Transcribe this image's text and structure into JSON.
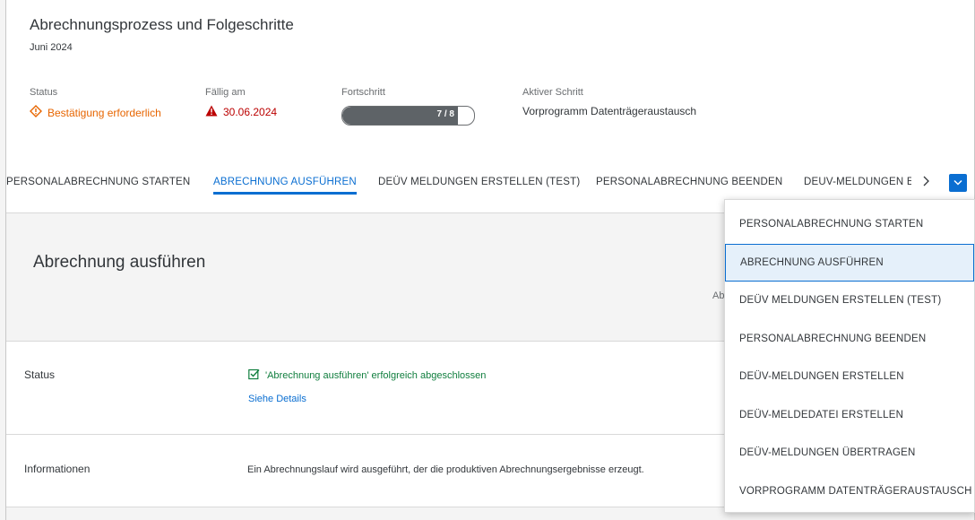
{
  "header": {
    "title": "Abrechnungsprozess und Folgeschritte",
    "subtitle": "Juni 2024",
    "status": {
      "label": "Status",
      "value": "Bestätigung erforderlich",
      "color": "#e76500"
    },
    "due": {
      "label": "Fällig am",
      "value": "30.06.2024",
      "color": "#bb0000"
    },
    "progress": {
      "label": "Fortschritt",
      "text": "7 / 8",
      "fraction": 0.875
    },
    "active_step": {
      "label": "Aktiver Schritt",
      "value": "Vorprogramm Datenträgeraustausch"
    }
  },
  "tabs": [
    {
      "label": "PERSONALABRECHNUNG STARTEN",
      "active": false
    },
    {
      "label": "ABRECHNUNG AUSFÜHREN",
      "active": true
    },
    {
      "label": "DEÜV MELDUNGEN ERSTELLEN (TEST)",
      "active": false
    },
    {
      "label": "PERSONALABRECHNUNG BEENDEN",
      "active": false
    },
    {
      "label": "DEÜV-MELDUNGEN E",
      "active": false
    }
  ],
  "section": {
    "title": "Abrechnung ausführen",
    "trail_text": "Ab"
  },
  "rows": {
    "status": {
      "label": "Status",
      "message": "'Abrechnung ausführen' erfolgreich abgeschlossen",
      "link": "Siehe Details"
    },
    "info": {
      "label": "Informationen",
      "text": "Ein Abrechnungslauf wird ausgeführt, der die produktiven Abrechnungsergebnisse erzeugt."
    }
  },
  "dropdown": {
    "items": [
      {
        "label": "PERSONALABRECHNUNG STARTEN",
        "selected": false
      },
      {
        "label": "ABRECHNUNG AUSFÜHREN",
        "selected": true
      },
      {
        "label": "DEÜV MELDUNGEN ERSTELLEN (TEST)",
        "selected": false
      },
      {
        "label": "PERSONALABRECHNUNG BEENDEN",
        "selected": false
      },
      {
        "label": "DEÜV-MELDUNGEN ERSTELLEN",
        "selected": false
      },
      {
        "label": "DEÜV-MELDEDATEI ERSTELLEN",
        "selected": false
      },
      {
        "label": "DEÜV-MELDUNGEN ÜBERTRAGEN",
        "selected": false
      },
      {
        "label": "VORPROGRAMM DATENTRÄGERAUSTAUSCH",
        "selected": false
      }
    ]
  },
  "colors": {
    "accent": "#0a6ed1",
    "success": "#107e3e",
    "warning": "#e76500",
    "error": "#bb0000"
  },
  "icons": {
    "status": "warning-diamond-icon",
    "due": "alert-triangle-icon",
    "success": "checkbox-checked-icon",
    "scroll": "chevron-right-icon",
    "overflow": "chevron-down-icon"
  }
}
